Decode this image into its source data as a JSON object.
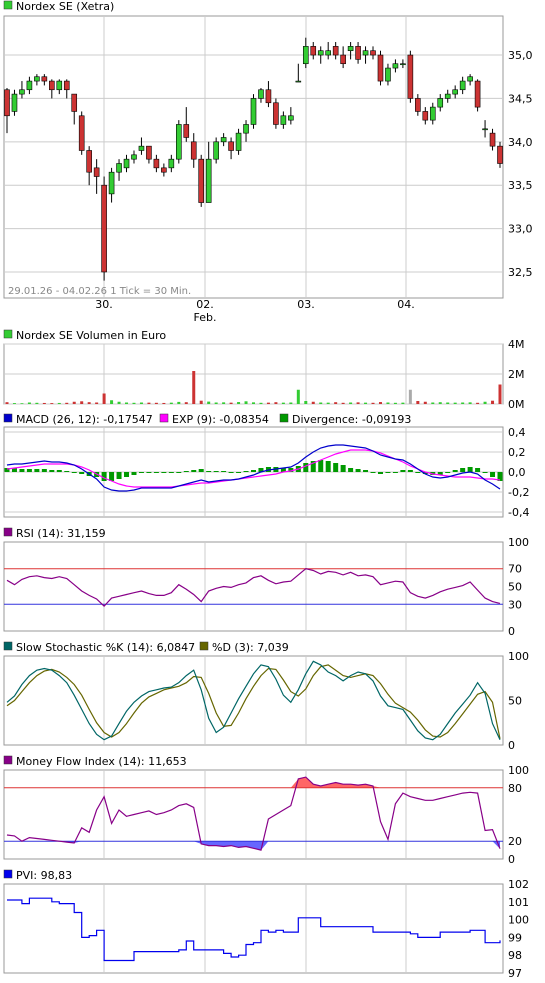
{
  "colors": {
    "up": "#33cc33",
    "down": "#cc3333",
    "grid": "#cccccc",
    "frame": "#999999",
    "macd": "#0000cc",
    "exp": "#ff00ff",
    "divergence": "#009900",
    "rsi": "#880088",
    "stoch_k": "#006666",
    "stoch_d": "#666600",
    "mfi": "#880088",
    "pvi": "#0000ee",
    "upper_line": "#dd3333",
    "lower_line": "#3333dd",
    "vol_gray": "#aaaaaa"
  },
  "chart_data": [
    {
      "id": "price",
      "type": "candlestick",
      "title": "Nordex SE (Xetra)",
      "footnote": "29.01.26 - 04.02.26    1 Tick = 30 Min.",
      "x_labels": [
        "30.",
        "02.",
        "03.",
        "04."
      ],
      "x_sublabels": [
        "",
        "Feb.",
        "",
        ""
      ],
      "ylim": [
        32.2,
        35.45
      ],
      "y_ticks": [
        "35,0",
        "34,5",
        "34,0",
        "33,5",
        "33,0",
        "32,5"
      ],
      "y_tick_values": [
        35.0,
        34.5,
        34.0,
        33.5,
        33.0,
        32.5
      ],
      "candles": [
        [
          34.6,
          34.3,
          34.62,
          34.1
        ],
        [
          34.35,
          34.55,
          34.6,
          34.3
        ],
        [
          34.55,
          34.6,
          34.7,
          34.5
        ],
        [
          34.6,
          34.7,
          34.75,
          34.55
        ],
        [
          34.7,
          34.75,
          34.78,
          34.65
        ],
        [
          34.75,
          34.7,
          34.78,
          34.65
        ],
        [
          34.7,
          34.6,
          34.72,
          34.5
        ],
        [
          34.6,
          34.7,
          34.72,
          34.55
        ],
        [
          34.7,
          34.6,
          34.72,
          34.5
        ],
        [
          34.55,
          34.35,
          34.55,
          34.2
        ],
        [
          34.3,
          33.9,
          34.35,
          33.85
        ],
        [
          33.9,
          33.65,
          33.95,
          33.5
        ],
        [
          33.7,
          33.6,
          33.8,
          33.4
        ],
        [
          33.5,
          32.5,
          33.6,
          32.4
        ],
        [
          33.4,
          33.65,
          33.7,
          33.3
        ],
        [
          33.65,
          33.75,
          33.8,
          33.55
        ],
        [
          33.7,
          33.8,
          33.85,
          33.65
        ],
        [
          33.8,
          33.85,
          33.9,
          33.75
        ],
        [
          33.9,
          33.95,
          34.05,
          33.85
        ],
        [
          33.95,
          33.8,
          33.95,
          33.75
        ],
        [
          33.8,
          33.7,
          33.85,
          33.65
        ],
        [
          33.7,
          33.65,
          33.75,
          33.6
        ],
        [
          33.7,
          33.8,
          33.85,
          33.65
        ],
        [
          33.8,
          34.2,
          34.25,
          33.75
        ],
        [
          34.2,
          34.05,
          34.4,
          34.0
        ],
        [
          34.0,
          33.8,
          34.1,
          33.7
        ],
        [
          33.8,
          33.3,
          33.85,
          33.25
        ],
        [
          33.3,
          33.8,
          34.0,
          33.3
        ],
        [
          33.8,
          34.0,
          34.05,
          33.75
        ],
        [
          34.0,
          34.05,
          34.1,
          33.95
        ],
        [
          34.0,
          33.9,
          34.05,
          33.8
        ],
        [
          33.9,
          34.1,
          34.15,
          33.85
        ],
        [
          34.1,
          34.2,
          34.25,
          34.0
        ],
        [
          34.2,
          34.5,
          34.55,
          34.15
        ],
        [
          34.5,
          34.6,
          34.62,
          34.45
        ],
        [
          34.6,
          34.45,
          34.7,
          34.4
        ],
        [
          34.45,
          34.2,
          34.5,
          34.15
        ],
        [
          34.2,
          34.3,
          34.35,
          34.15
        ],
        [
          34.25,
          34.3,
          34.4,
          34.2
        ],
        [
          34.7,
          34.7,
          34.9,
          34.7
        ],
        [
          34.9,
          35.1,
          35.2,
          34.85
        ],
        [
          35.1,
          35.0,
          35.15,
          34.95
        ],
        [
          35.0,
          35.05,
          35.1,
          34.9
        ],
        [
          35.0,
          35.05,
          35.15,
          34.95
        ],
        [
          35.1,
          35.0,
          35.15,
          34.95
        ],
        [
          35.0,
          34.9,
          35.1,
          34.85
        ],
        [
          35.05,
          35.1,
          35.15,
          34.95
        ],
        [
          35.1,
          34.95,
          35.15,
          34.9
        ],
        [
          35.0,
          35.05,
          35.1,
          34.9
        ],
        [
          35.05,
          35.0,
          35.1,
          34.95
        ],
        [
          35.0,
          34.7,
          35.05,
          34.65
        ],
        [
          34.7,
          34.85,
          34.9,
          34.65
        ],
        [
          34.85,
          34.9,
          34.95,
          34.8
        ],
        [
          34.9,
          34.9,
          34.95,
          34.85
        ],
        [
          35.0,
          34.5,
          35.05,
          34.45
        ],
        [
          34.5,
          34.35,
          34.55,
          34.3
        ],
        [
          34.35,
          34.25,
          34.4,
          34.2
        ],
        [
          34.25,
          34.4,
          34.45,
          34.2
        ],
        [
          34.4,
          34.5,
          34.55,
          34.35
        ],
        [
          34.5,
          34.55,
          34.6,
          34.45
        ],
        [
          34.55,
          34.6,
          34.65,
          34.5
        ],
        [
          34.6,
          34.7,
          34.75,
          34.55
        ],
        [
          34.7,
          34.75,
          34.78,
          34.65
        ],
        [
          34.7,
          34.4,
          34.72,
          34.35
        ],
        [
          34.15,
          34.15,
          34.25,
          34.05
        ],
        [
          34.1,
          33.95,
          34.15,
          33.9
        ],
        [
          33.95,
          33.75,
          34.0,
          33.7
        ]
      ]
    },
    {
      "id": "volume",
      "type": "bar",
      "title": "Nordex SE Volumen in Euro",
      "ylim": [
        0,
        40
      ],
      "y_ticks": [
        "4M",
        "2M",
        "0M"
      ],
      "y_tick_values": [
        40,
        20,
        0
      ],
      "values": [
        1.2,
        0.6,
        0.5,
        1.0,
        0.8,
        0.7,
        0.6,
        0.7,
        0.8,
        1.5,
        1.8,
        1.2,
        1.0,
        7.0,
        2.5,
        1.5,
        1.0,
        0.8,
        1.0,
        0.9,
        0.8,
        0.7,
        0.9,
        1.4,
        1.2,
        22.0,
        2.2,
        1.6,
        1.0,
        1.1,
        0.9,
        1.3,
        1.8,
        1.1,
        0.8,
        0.9,
        1.2,
        0.9,
        1.0,
        9.5,
        2.0,
        1.5,
        1.0,
        0.9,
        1.2,
        0.8,
        1.0,
        1.1,
        0.9,
        0.8,
        1.3,
        1.0,
        0.8,
        0.9,
        9.5,
        2.0,
        1.5,
        1.0,
        1.2,
        1.0,
        0.9,
        1.0,
        1.1,
        0.8,
        1.5,
        2.2,
        13.0
      ]
    },
    {
      "id": "macd",
      "type": "line",
      "series_labels": [
        "MACD (26, 12): -0,17547",
        "EXP (9): -0,08354",
        "Divergence: -0,09193"
      ],
      "ylim": [
        -0.45,
        0.45
      ],
      "y_ticks": [
        "0,4",
        "0,2",
        "0,0",
        "-0,2",
        "-0,4"
      ],
      "y_tick_values": [
        0.4,
        0.2,
        0.0,
        -0.2,
        -0.4
      ],
      "macd": [
        0.07,
        0.08,
        0.08,
        0.09,
        0.1,
        0.11,
        0.1,
        0.1,
        0.09,
        0.07,
        0.03,
        -0.02,
        -0.07,
        -0.15,
        -0.18,
        -0.19,
        -0.19,
        -0.18,
        -0.16,
        -0.16,
        -0.16,
        -0.16,
        -0.16,
        -0.14,
        -0.12,
        -0.1,
        -0.08,
        -0.1,
        -0.09,
        -0.08,
        -0.08,
        -0.07,
        -0.05,
        -0.03,
        0.0,
        0.02,
        0.03,
        0.04,
        0.05,
        0.09,
        0.15,
        0.2,
        0.24,
        0.26,
        0.27,
        0.27,
        0.26,
        0.25,
        0.24,
        0.21,
        0.17,
        0.15,
        0.13,
        0.12,
        0.08,
        0.03,
        -0.02,
        -0.05,
        -0.06,
        -0.05,
        -0.03,
        -0.01,
        0.0,
        -0.02,
        -0.08,
        -0.12,
        -0.17
      ],
      "exp": [
        0.03,
        0.04,
        0.05,
        0.06,
        0.07,
        0.08,
        0.08,
        0.08,
        0.08,
        0.07,
        0.05,
        0.02,
        -0.02,
        -0.06,
        -0.09,
        -0.12,
        -0.14,
        -0.15,
        -0.15,
        -0.15,
        -0.15,
        -0.15,
        -0.15,
        -0.14,
        -0.13,
        -0.12,
        -0.11,
        -0.11,
        -0.1,
        -0.09,
        -0.08,
        -0.07,
        -0.06,
        -0.05,
        -0.04,
        -0.03,
        -0.02,
        0.0,
        0.01,
        0.03,
        0.06,
        0.09,
        0.12,
        0.15,
        0.18,
        0.2,
        0.22,
        0.22,
        0.22,
        0.21,
        0.19,
        0.16,
        0.13,
        0.1,
        0.06,
        0.03,
        0.0,
        -0.02,
        -0.03,
        -0.04,
        -0.05,
        -0.05,
        -0.05,
        -0.06,
        -0.07,
        -0.07,
        -0.08
      ],
      "divergence": [
        0.04,
        0.04,
        0.03,
        0.03,
        0.03,
        0.03,
        0.02,
        0.02,
        0.01,
        0.0,
        -0.02,
        -0.04,
        -0.05,
        -0.09,
        -0.09,
        -0.07,
        -0.05,
        -0.03,
        -0.01,
        -0.01,
        -0.01,
        -0.01,
        -0.01,
        0.0,
        0.01,
        0.02,
        0.03,
        0.01,
        0.01,
        0.01,
        0.0,
        0.0,
        0.01,
        0.02,
        0.04,
        0.05,
        0.05,
        0.04,
        0.04,
        0.06,
        0.09,
        0.11,
        0.12,
        0.11,
        0.09,
        0.07,
        0.04,
        0.03,
        0.02,
        0.0,
        -0.02,
        -0.01,
        0.0,
        0.02,
        0.02,
        0.0,
        -0.02,
        -0.03,
        -0.03,
        -0.01,
        0.02,
        0.04,
        0.05,
        0.04,
        -0.01,
        -0.05,
        -0.09
      ]
    },
    {
      "id": "rsi",
      "type": "line",
      "series_labels": [
        "RSI (14): 31,159"
      ],
      "ylim": [
        0,
        100
      ],
      "y_ticks": [
        "100",
        "70",
        "50",
        "30",
        "0"
      ],
      "y_tick_values": [
        100,
        70,
        50,
        30,
        0
      ],
      "upper": 70,
      "lower": 30,
      "values": [
        57,
        52,
        58,
        61,
        62,
        60,
        59,
        61,
        59,
        52,
        45,
        40,
        36,
        28,
        37,
        39,
        41,
        43,
        45,
        42,
        40,
        40,
        43,
        52,
        47,
        41,
        33,
        45,
        48,
        50,
        49,
        52,
        54,
        60,
        62,
        57,
        53,
        55,
        56,
        63,
        70,
        68,
        64,
        67,
        66,
        63,
        66,
        62,
        63,
        61,
        52,
        54,
        56,
        55,
        43,
        39,
        37,
        40,
        44,
        47,
        49,
        51,
        55,
        46,
        37,
        33,
        31
      ]
    },
    {
      "id": "stochastic",
      "type": "line",
      "series_labels": [
        "Slow Stochastic %K (14): 6,0847",
        "%D (3): 7,039"
      ],
      "ylim": [
        0,
        100
      ],
      "y_ticks": [
        "100",
        "50",
        "0"
      ],
      "y_tick_values": [
        100,
        50,
        0
      ],
      "k": [
        48,
        55,
        68,
        78,
        84,
        86,
        84,
        78,
        70,
        56,
        40,
        24,
        12,
        6,
        10,
        24,
        38,
        48,
        55,
        60,
        62,
        64,
        65,
        70,
        78,
        84,
        62,
        30,
        14,
        20,
        36,
        52,
        66,
        80,
        90,
        88,
        74,
        56,
        48,
        62,
        80,
        94,
        90,
        82,
        78,
        72,
        78,
        82,
        80,
        72,
        55,
        44,
        42,
        40,
        28,
        16,
        8,
        6,
        12,
        24,
        36,
        46,
        56,
        70,
        58,
        24,
        6
      ],
      "d": [
        44,
        50,
        60,
        70,
        78,
        83,
        85,
        82,
        76,
        68,
        56,
        40,
        25,
        14,
        9,
        14,
        24,
        36,
        47,
        54,
        58,
        62,
        64,
        66,
        70,
        77,
        76,
        58,
        36,
        21,
        22,
        36,
        52,
        66,
        78,
        86,
        85,
        73,
        60,
        55,
        63,
        78,
        88,
        90,
        84,
        78,
        76,
        78,
        80,
        78,
        69,
        57,
        47,
        42,
        37,
        28,
        17,
        10,
        9,
        14,
        24,
        35,
        46,
        57,
        60,
        48,
        7
      ]
    },
    {
      "id": "mfi",
      "type": "line",
      "series_labels": [
        "Money Flow Index (14): 11,653"
      ],
      "ylim": [
        0,
        100
      ],
      "y_ticks": [
        "100",
        "80",
        "20",
        "0"
      ],
      "y_tick_values": [
        100,
        80,
        20,
        0
      ],
      "upper": 80,
      "lower": 20,
      "values": [
        27,
        26,
        20,
        24,
        23,
        22,
        21,
        20,
        19,
        18,
        35,
        30,
        55,
        70,
        40,
        55,
        48,
        50,
        52,
        54,
        50,
        52,
        55,
        60,
        62,
        58,
        17,
        15,
        15,
        14,
        15,
        13,
        14,
        12,
        10,
        45,
        50,
        55,
        60,
        90,
        92,
        84,
        82,
        84,
        86,
        84,
        84,
        83,
        84,
        82,
        42,
        22,
        62,
        74,
        70,
        68,
        66,
        66,
        68,
        70,
        72,
        74,
        75,
        74,
        32,
        33,
        11.6
      ]
    },
    {
      "id": "pvi",
      "type": "line",
      "series_labels": [
        "PVI: 98,83"
      ],
      "ylim": [
        97,
        102
      ],
      "y_ticks": [
        "102",
        "101",
        "100",
        "99",
        "98",
        "97"
      ],
      "y_tick_values": [
        102,
        101,
        100,
        99,
        98,
        97
      ],
      "values": [
        101.1,
        101.1,
        100.9,
        101.2,
        101.2,
        101.2,
        101.0,
        100.9,
        100.9,
        100.4,
        99.0,
        99.1,
        99.4,
        97.7,
        97.7,
        97.7,
        97.7,
        98.2,
        98.2,
        98.2,
        98.2,
        98.2,
        98.2,
        98.3,
        98.8,
        98.3,
        98.3,
        98.3,
        98.3,
        98.1,
        97.9,
        98.0,
        98.6,
        98.7,
        99.4,
        99.3,
        99.4,
        99.3,
        99.3,
        100.1,
        100.1,
        100.1,
        99.6,
        99.6,
        99.6,
        99.6,
        99.6,
        99.6,
        99.6,
        99.3,
        99.3,
        99.3,
        99.3,
        99.3,
        99.2,
        99.0,
        99.0,
        99.0,
        99.3,
        99.3,
        99.3,
        99.3,
        99.4,
        99.4,
        98.7,
        98.7,
        98.83
      ]
    }
  ]
}
